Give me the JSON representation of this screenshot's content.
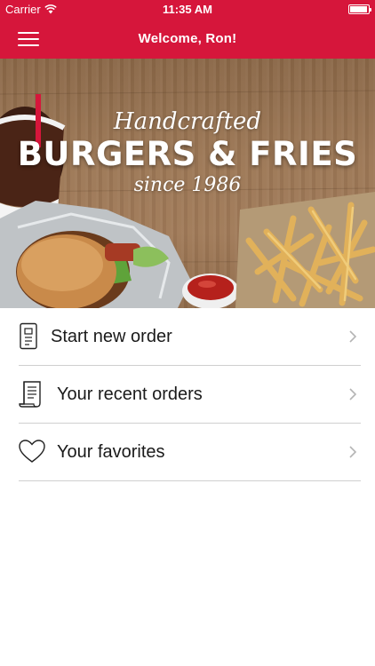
{
  "status_bar": {
    "carrier": "Carrier",
    "time": "11:35 AM",
    "battery_level": 0.95
  },
  "nav": {
    "title": "Welcome, Ron!",
    "menu_icon": "hamburger-menu-icon"
  },
  "hero": {
    "tagline_top": "Handcrafted",
    "headline": "BURGERS & FRIES",
    "since": "since 1986"
  },
  "menu": {
    "items": [
      {
        "label": "Start new order",
        "icon": "order-receipt-icon"
      },
      {
        "label": "Your recent orders",
        "icon": "receipt-scroll-icon"
      },
      {
        "label": "Your favorites",
        "icon": "heart-icon"
      }
    ]
  },
  "colors": {
    "brand_red": "#d6163b",
    "divider": "#cfcfcf",
    "chevron": "#b4b4b4"
  }
}
